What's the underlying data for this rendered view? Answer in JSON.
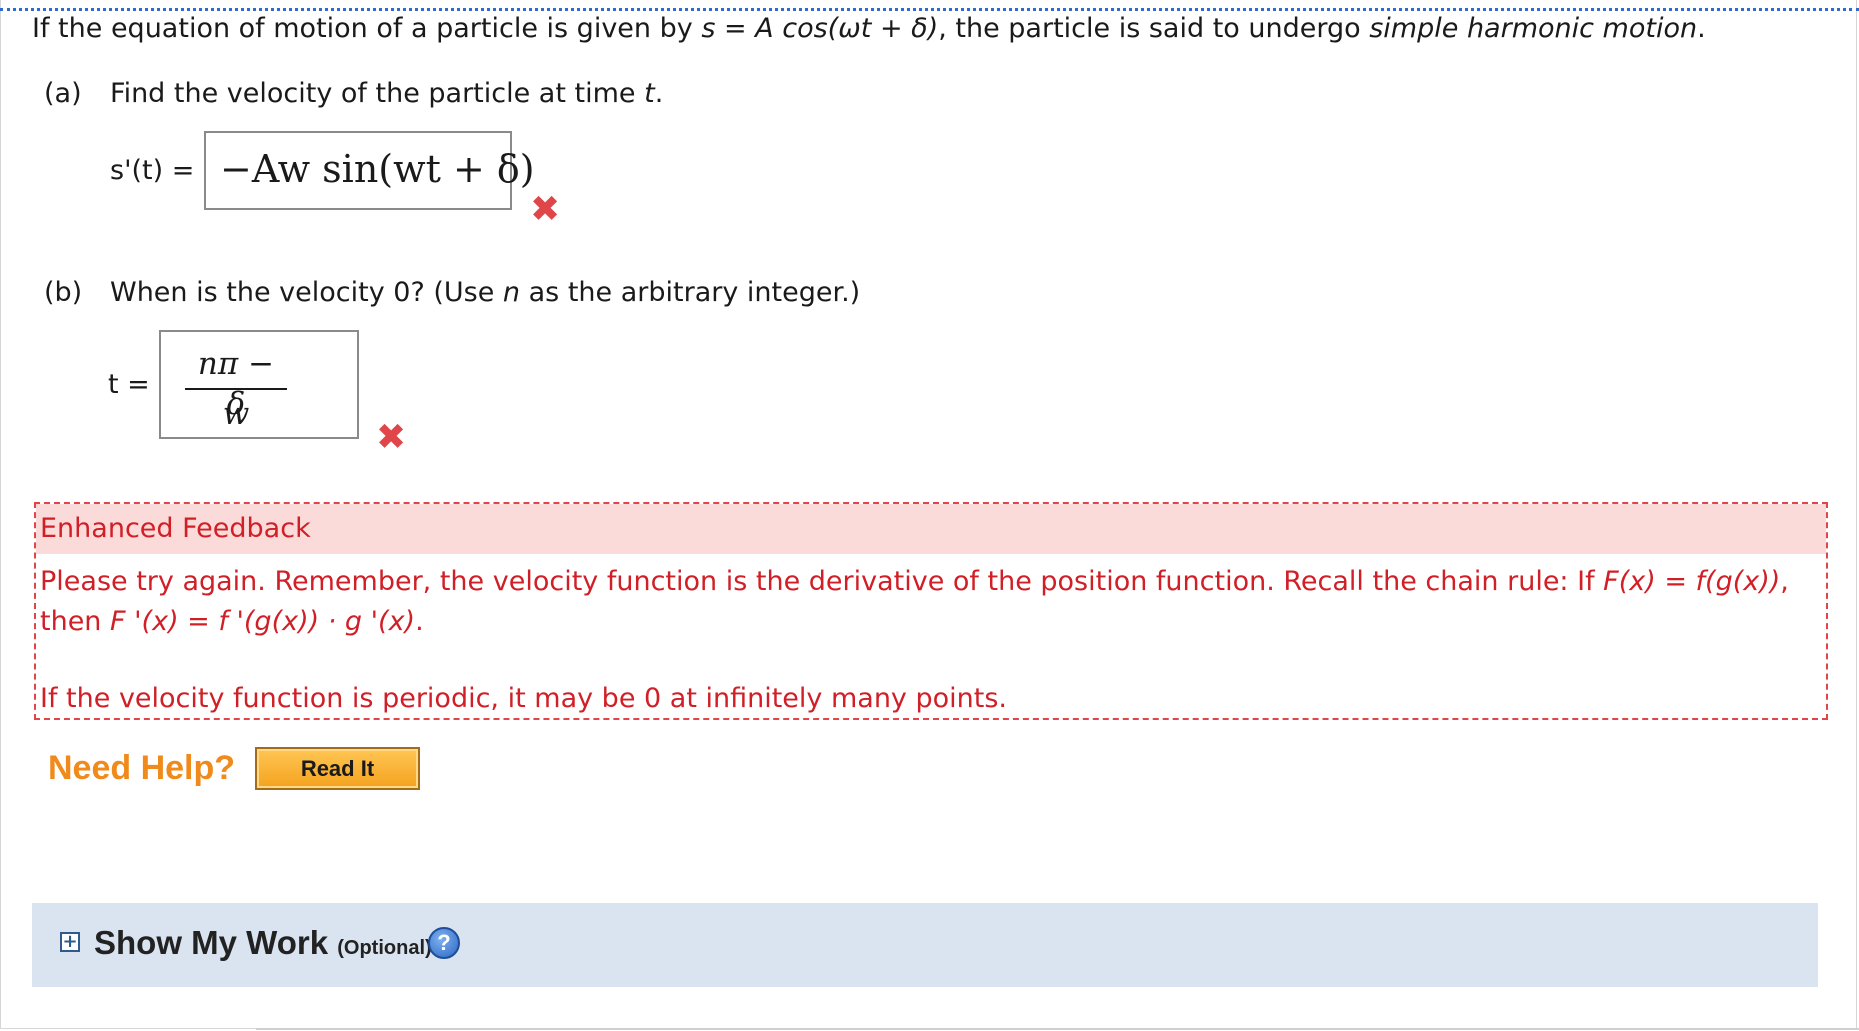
{
  "question": {
    "pre": "If the equation of motion of a particle is given by ",
    "formula": "s = A cos(ωt + δ)",
    "mid": ", the particle is said to undergo ",
    "term": "simple harmonic motion",
    "end": "."
  },
  "part_a": {
    "tag": "(a)",
    "prompt_pre": "Find the velocity of the particle at time ",
    "prompt_var": "t",
    "prompt_end": ".",
    "answer_label": "s'(t) =",
    "answer_value": "−Aw sin(wt + δ)",
    "result": "incorrect"
  },
  "part_b": {
    "tag": "(b)",
    "prompt_pre": "When is the velocity 0? (Use ",
    "prompt_var": "n",
    "prompt_end": " as the arbitrary integer.)",
    "answer_label": "t =",
    "answer_numerator": "nπ − δ",
    "answer_denominator": "w",
    "result": "incorrect"
  },
  "feedback": {
    "title": "Enhanced Feedback",
    "text1_pre": "Please try again. Remember, the velocity function is the derivative of the position function. Recall the chain rule: If ",
    "text1_rule": "F(x) = f(g(x))",
    "text1_mid": ", then ",
    "text1_rule2": "F '(x) = f '(g(x)) · g '(x)",
    "text1_end": ".",
    "text2": "If the velocity function is periodic, it may be 0 at infinitely many points."
  },
  "help": {
    "label": "Need Help?",
    "read_it": "Read It"
  },
  "show_work": {
    "expand": "+",
    "title": "Show My Work",
    "optional": "(Optional)",
    "help_icon": "?"
  },
  "colors": {
    "error": "#d01f26",
    "feedback_bg": "#fbdada",
    "need_help": "#f08a1a",
    "show_work_bg": "#d9e4f0"
  }
}
